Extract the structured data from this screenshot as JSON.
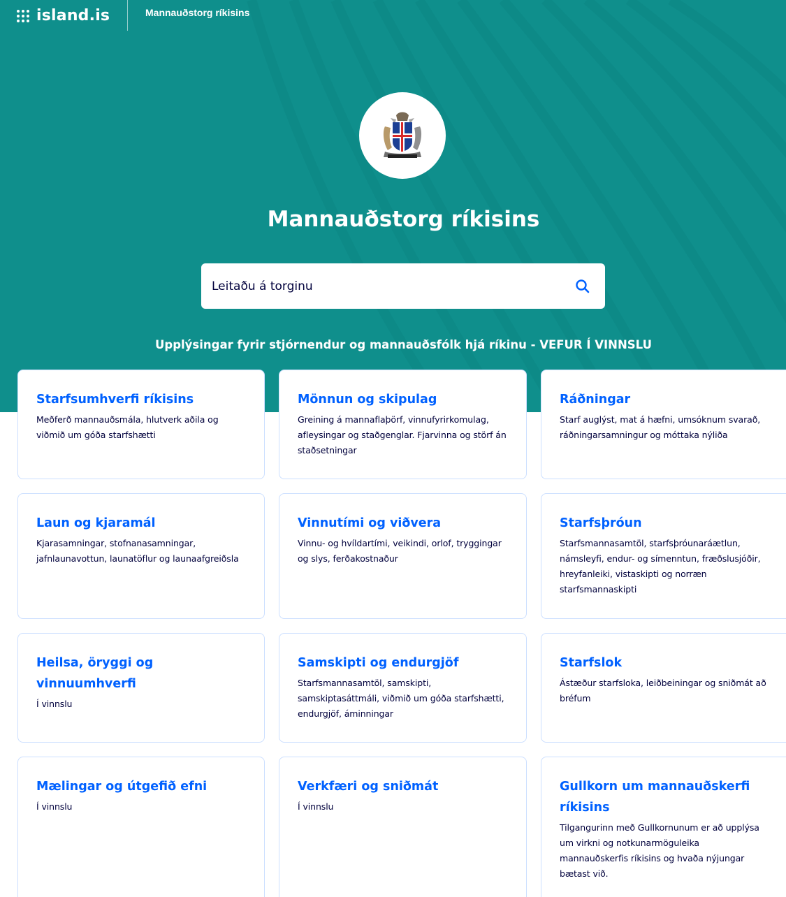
{
  "header": {
    "logo_text": "island.is",
    "site_name": "Mannauðstorg ríkisins"
  },
  "hero": {
    "title": "Mannauðstorg ríkisins",
    "subtitle": "Upplýsingar fyrir stjórnendur og mannauðsfólk hjá ríkinu - VEFUR Í VINNSLU",
    "emblem_icon": "icelandic-coat-of-arms-icon"
  },
  "search": {
    "placeholder": "Leitaðu á torginu",
    "icon": "search-icon"
  },
  "colors": {
    "hero_background": "#0f8f8c",
    "card_title": "#0061ff",
    "card_text": "#00003c",
    "card_border": "#ccdfff"
  },
  "cards": [
    {
      "title": "Starfsumhverfi ríkisins",
      "description": "Meðferð mannauðsmála, hlutverk aðila og viðmið um góða starfshætti"
    },
    {
      "title": "Mönnun og skipulag",
      "description": "Greining á mannaflaþörf, vinnufyrirkomulag, afleysingar og staðgenglar. Fjarvinna og störf án staðsetningar"
    },
    {
      "title": "Ráðningar",
      "description": "Starf auglýst, mat á hæfni, umsóknum svarað, ráðningarsamningur og móttaka nýliða"
    },
    {
      "title": "Laun og kjaramál",
      "description": "Kjarasamningar, stofnanasamningar, jafnlaunavottun, launatöflur og launaafgreiðsla"
    },
    {
      "title": "Vinnutími og viðvera",
      "description": "Vinnu- og hvíldartími, veikindi, orlof, tryggingar og slys, ferðakostnaður"
    },
    {
      "title": "Starfsþróun",
      "description": "Starfsmannasamtöl, starfsþróunaráætlun, námsleyfi, endur- og símenntun, fræðslusjóðir, hreyfanleiki, vistaskipti og norræn starfsmannaskipti"
    },
    {
      "title": "Heilsa, öryggi og vinnuumhverfi",
      "description": "Í vinnslu"
    },
    {
      "title": "Samskipti og endurgjöf",
      "description": "Starfsmannasamtöl, samskipti, samskiptasáttmáli, viðmið um góða starfshætti, endurgjöf, áminningar"
    },
    {
      "title": "Starfslok",
      "description": "Ástæður starfsloka, leiðbeiningar og sniðmát að bréfum"
    },
    {
      "title": "Mælingar og útgefið efni",
      "description": "Í vinnslu"
    },
    {
      "title": "Verkfæri og sniðmát",
      "description": "Í vinnslu"
    },
    {
      "title": "Gullkorn um mannauðskerfi ríkisins",
      "description": "Tilgangurinn með Gullkornunum er að upplýsa um virkni og notkunarmöguleika mannauðskerfis ríkisins og hvaða nýjungar bætast við."
    }
  ]
}
